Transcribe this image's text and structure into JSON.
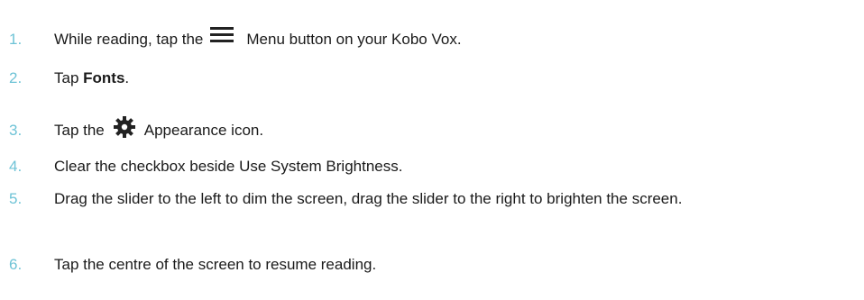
{
  "steps": [
    {
      "number": "1.",
      "before": "While reading, tap the",
      "icon": "menu-icon",
      "after": "Menu button on your Kobo Vox."
    },
    {
      "number": "2.",
      "before": "Tap ",
      "bold": "Fonts",
      "after": "."
    },
    {
      "number": "3.",
      "before": "Tap the",
      "icon": "gear-icon",
      "after": "Appearance icon."
    },
    {
      "number": "4.",
      "text": "Clear the checkbox beside Use System Brightness."
    },
    {
      "number": "5.",
      "text": "Drag the slider to the left to dim the screen, drag the slider to the right to brighten the screen."
    },
    {
      "number": "6.",
      "text": "Tap the centre of the screen to resume reading."
    }
  ],
  "colors": {
    "number": "#6ec3d6",
    "text": "#1a1a1a",
    "icon": "#222222"
  }
}
